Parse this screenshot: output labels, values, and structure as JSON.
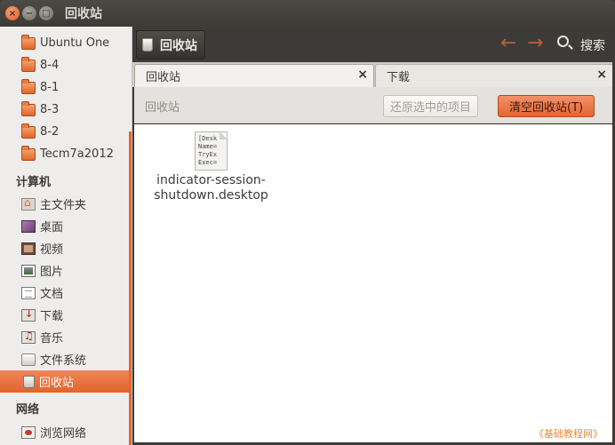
{
  "window": {
    "title": "回收站",
    "close_symbol": "×",
    "min_symbol": "−",
    "max_symbol": "□"
  },
  "sidebar": {
    "items_top": [
      {
        "label": "Ubuntu One",
        "icon": "folder-icon"
      },
      {
        "label": "8-4",
        "icon": "folder-icon"
      },
      {
        "label": "8-1",
        "icon": "folder-icon"
      },
      {
        "label": "8-3",
        "icon": "folder-icon"
      },
      {
        "label": "8-2",
        "icon": "folder-icon"
      },
      {
        "label": "Tecm7a2012",
        "icon": "folder-icon"
      }
    ],
    "computer_heading": "计算机",
    "computer_items": [
      {
        "label": "主文件夹",
        "icon": "home-folder-icon"
      },
      {
        "label": "桌面",
        "icon": "desktop-icon"
      },
      {
        "label": "视频",
        "icon": "video-icon"
      },
      {
        "label": "图片",
        "icon": "pictures-icon"
      },
      {
        "label": "文档",
        "icon": "documents-icon"
      },
      {
        "label": "下载",
        "icon": "downloads-icon"
      },
      {
        "label": "音乐",
        "icon": "music-icon"
      },
      {
        "label": "文件系统",
        "icon": "filesystem-icon"
      },
      {
        "label": "回收站",
        "icon": "trash-icon",
        "active": true
      }
    ],
    "network_heading": "网络",
    "network_items": [
      {
        "label": "浏览网络",
        "icon": "network-icon"
      }
    ]
  },
  "toolbar": {
    "location_label": "回收站",
    "back_symbol": "←",
    "forward_symbol": "→",
    "search_label": "搜索"
  },
  "tabs": [
    {
      "label": "回收站",
      "close": "×",
      "active": true
    },
    {
      "label": "下载",
      "close": "×",
      "active": false
    }
  ],
  "infobar": {
    "label": "回收站",
    "restore_button": "还原选中的项目",
    "empty_button": "清空回收站(T)"
  },
  "files": [
    {
      "name_line1": "indicator-session-",
      "name_line2": "shutdown.desktop",
      "preview": [
        "[Desk",
        "Name=",
        "TryEx",
        "Exec="
      ]
    }
  ],
  "watermark": "《基础教程网》",
  "colors": {
    "accent": "#e1632c",
    "titlebar": "#3c3b37",
    "sidebar_bg": "#efedec"
  }
}
